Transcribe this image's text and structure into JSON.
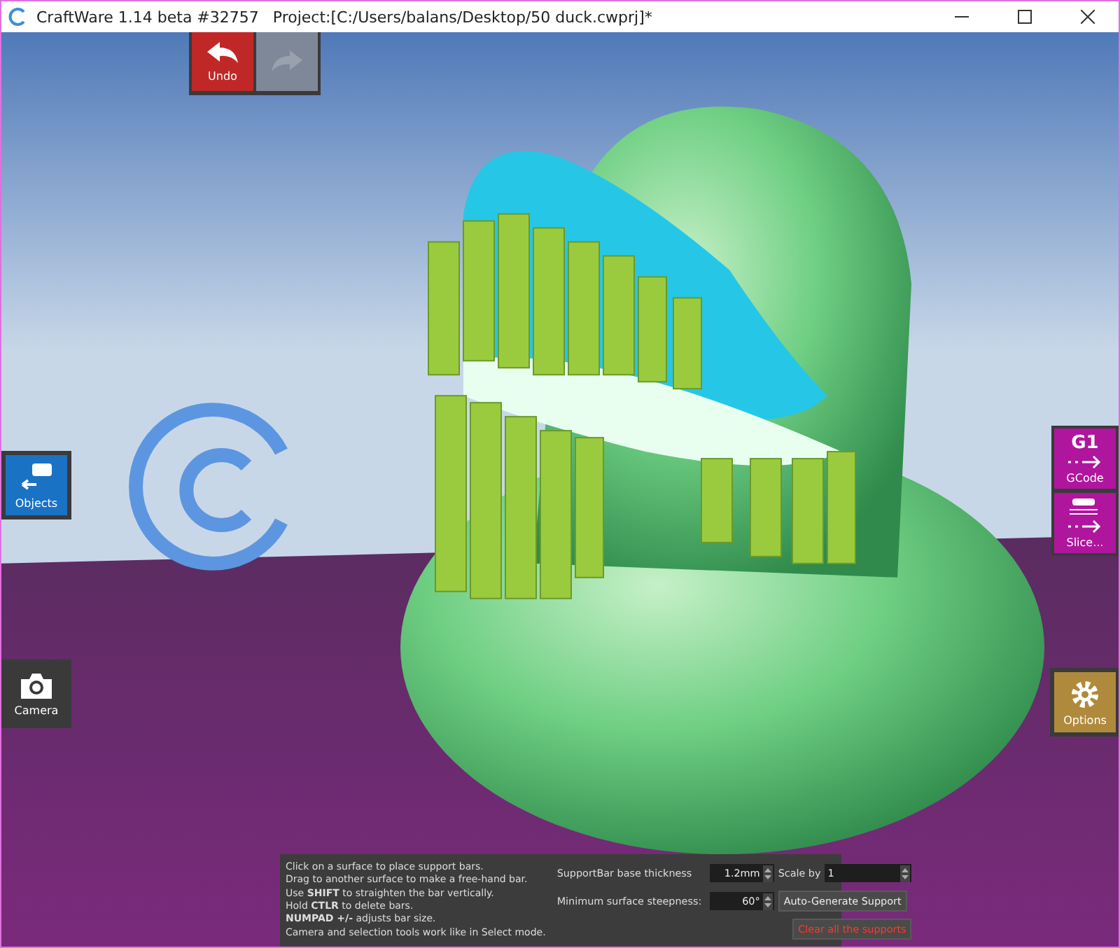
{
  "window": {
    "app_name": "CraftWare 1.14 beta #32757",
    "project": "Project:[C:/Users/balans/Desktop/50 duck.cwprj]*"
  },
  "history": [
    {
      "kind": "undo",
      "label": "Undo",
      "disabled": false
    },
    {
      "kind": "redo",
      "disabled": true
    }
  ],
  "left_tools": [
    {
      "kind": "objects",
      "label": "Objects",
      "color": "#1a72c4"
    },
    {
      "kind": "camera",
      "label": "Camera",
      "color": "#3a3a3a"
    }
  ],
  "right_tools": [
    {
      "kind": "gcode",
      "icon_text": "G1",
      "label": "GCode",
      "color": "#b0159e"
    },
    {
      "kind": "slice",
      "label": "Slice...",
      "color": "#b0159e"
    }
  ],
  "options": {
    "label": "Options",
    "color": "#b08a3c"
  },
  "support_panel": {
    "instructions": [
      "Click on a surface to place support bars.",
      "Drag to another surface to make a free-hand bar.",
      "Use **SHIFT** to straighten the bar vertically.",
      "Hold **CTLR** to delete bars.",
      "**NUMPAD +/-** adjusts bar size.",
      "Camera and selection tools work like in Select mode."
    ],
    "base_thickness": {
      "label": "SupportBar base thickness",
      "value": "1.2mm"
    },
    "scale": {
      "label": "Scale by",
      "value": "1"
    },
    "steepness": {
      "label": "Minimum surface steepness:",
      "value": "60°"
    },
    "auto_button": "Auto-Generate Support",
    "clear_button": "Clear all the supports"
  }
}
